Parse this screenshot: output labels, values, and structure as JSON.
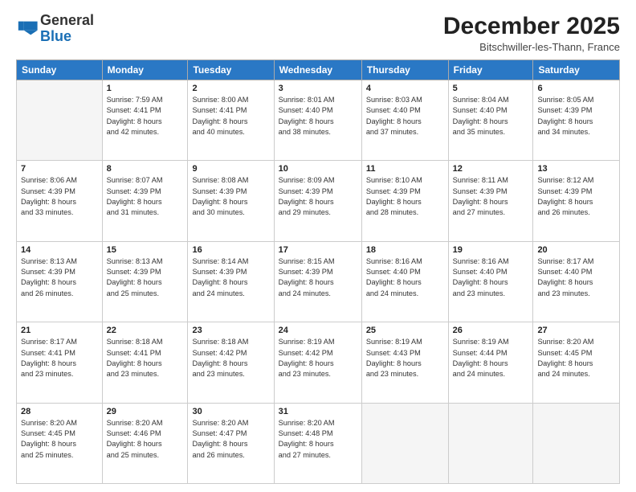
{
  "header": {
    "logo_general": "General",
    "logo_blue": "Blue",
    "month_title": "December 2025",
    "location": "Bitschwiller-les-Thann, France"
  },
  "days_of_week": [
    "Sunday",
    "Monday",
    "Tuesday",
    "Wednesday",
    "Thursday",
    "Friday",
    "Saturday"
  ],
  "weeks": [
    [
      {
        "day": "",
        "info": ""
      },
      {
        "day": "1",
        "info": "Sunrise: 7:59 AM\nSunset: 4:41 PM\nDaylight: 8 hours\nand 42 minutes."
      },
      {
        "day": "2",
        "info": "Sunrise: 8:00 AM\nSunset: 4:41 PM\nDaylight: 8 hours\nand 40 minutes."
      },
      {
        "day": "3",
        "info": "Sunrise: 8:01 AM\nSunset: 4:40 PM\nDaylight: 8 hours\nand 38 minutes."
      },
      {
        "day": "4",
        "info": "Sunrise: 8:03 AM\nSunset: 4:40 PM\nDaylight: 8 hours\nand 37 minutes."
      },
      {
        "day": "5",
        "info": "Sunrise: 8:04 AM\nSunset: 4:40 PM\nDaylight: 8 hours\nand 35 minutes."
      },
      {
        "day": "6",
        "info": "Sunrise: 8:05 AM\nSunset: 4:39 PM\nDaylight: 8 hours\nand 34 minutes."
      }
    ],
    [
      {
        "day": "7",
        "info": "Sunrise: 8:06 AM\nSunset: 4:39 PM\nDaylight: 8 hours\nand 33 minutes."
      },
      {
        "day": "8",
        "info": "Sunrise: 8:07 AM\nSunset: 4:39 PM\nDaylight: 8 hours\nand 31 minutes."
      },
      {
        "day": "9",
        "info": "Sunrise: 8:08 AM\nSunset: 4:39 PM\nDaylight: 8 hours\nand 30 minutes."
      },
      {
        "day": "10",
        "info": "Sunrise: 8:09 AM\nSunset: 4:39 PM\nDaylight: 8 hours\nand 29 minutes."
      },
      {
        "day": "11",
        "info": "Sunrise: 8:10 AM\nSunset: 4:39 PM\nDaylight: 8 hours\nand 28 minutes."
      },
      {
        "day": "12",
        "info": "Sunrise: 8:11 AM\nSunset: 4:39 PM\nDaylight: 8 hours\nand 27 minutes."
      },
      {
        "day": "13",
        "info": "Sunrise: 8:12 AM\nSunset: 4:39 PM\nDaylight: 8 hours\nand 26 minutes."
      }
    ],
    [
      {
        "day": "14",
        "info": "Sunrise: 8:13 AM\nSunset: 4:39 PM\nDaylight: 8 hours\nand 26 minutes."
      },
      {
        "day": "15",
        "info": "Sunrise: 8:13 AM\nSunset: 4:39 PM\nDaylight: 8 hours\nand 25 minutes."
      },
      {
        "day": "16",
        "info": "Sunrise: 8:14 AM\nSunset: 4:39 PM\nDaylight: 8 hours\nand 24 minutes."
      },
      {
        "day": "17",
        "info": "Sunrise: 8:15 AM\nSunset: 4:39 PM\nDaylight: 8 hours\nand 24 minutes."
      },
      {
        "day": "18",
        "info": "Sunrise: 8:16 AM\nSunset: 4:40 PM\nDaylight: 8 hours\nand 24 minutes."
      },
      {
        "day": "19",
        "info": "Sunrise: 8:16 AM\nSunset: 4:40 PM\nDaylight: 8 hours\nand 23 minutes."
      },
      {
        "day": "20",
        "info": "Sunrise: 8:17 AM\nSunset: 4:40 PM\nDaylight: 8 hours\nand 23 minutes."
      }
    ],
    [
      {
        "day": "21",
        "info": "Sunrise: 8:17 AM\nSunset: 4:41 PM\nDaylight: 8 hours\nand 23 minutes."
      },
      {
        "day": "22",
        "info": "Sunrise: 8:18 AM\nSunset: 4:41 PM\nDaylight: 8 hours\nand 23 minutes."
      },
      {
        "day": "23",
        "info": "Sunrise: 8:18 AM\nSunset: 4:42 PM\nDaylight: 8 hours\nand 23 minutes."
      },
      {
        "day": "24",
        "info": "Sunrise: 8:19 AM\nSunset: 4:42 PM\nDaylight: 8 hours\nand 23 minutes."
      },
      {
        "day": "25",
        "info": "Sunrise: 8:19 AM\nSunset: 4:43 PM\nDaylight: 8 hours\nand 23 minutes."
      },
      {
        "day": "26",
        "info": "Sunrise: 8:19 AM\nSunset: 4:44 PM\nDaylight: 8 hours\nand 24 minutes."
      },
      {
        "day": "27",
        "info": "Sunrise: 8:20 AM\nSunset: 4:45 PM\nDaylight: 8 hours\nand 24 minutes."
      }
    ],
    [
      {
        "day": "28",
        "info": "Sunrise: 8:20 AM\nSunset: 4:45 PM\nDaylight: 8 hours\nand 25 minutes."
      },
      {
        "day": "29",
        "info": "Sunrise: 8:20 AM\nSunset: 4:46 PM\nDaylight: 8 hours\nand 25 minutes."
      },
      {
        "day": "30",
        "info": "Sunrise: 8:20 AM\nSunset: 4:47 PM\nDaylight: 8 hours\nand 26 minutes."
      },
      {
        "day": "31",
        "info": "Sunrise: 8:20 AM\nSunset: 4:48 PM\nDaylight: 8 hours\nand 27 minutes."
      },
      {
        "day": "",
        "info": ""
      },
      {
        "day": "",
        "info": ""
      },
      {
        "day": "",
        "info": ""
      }
    ]
  ]
}
